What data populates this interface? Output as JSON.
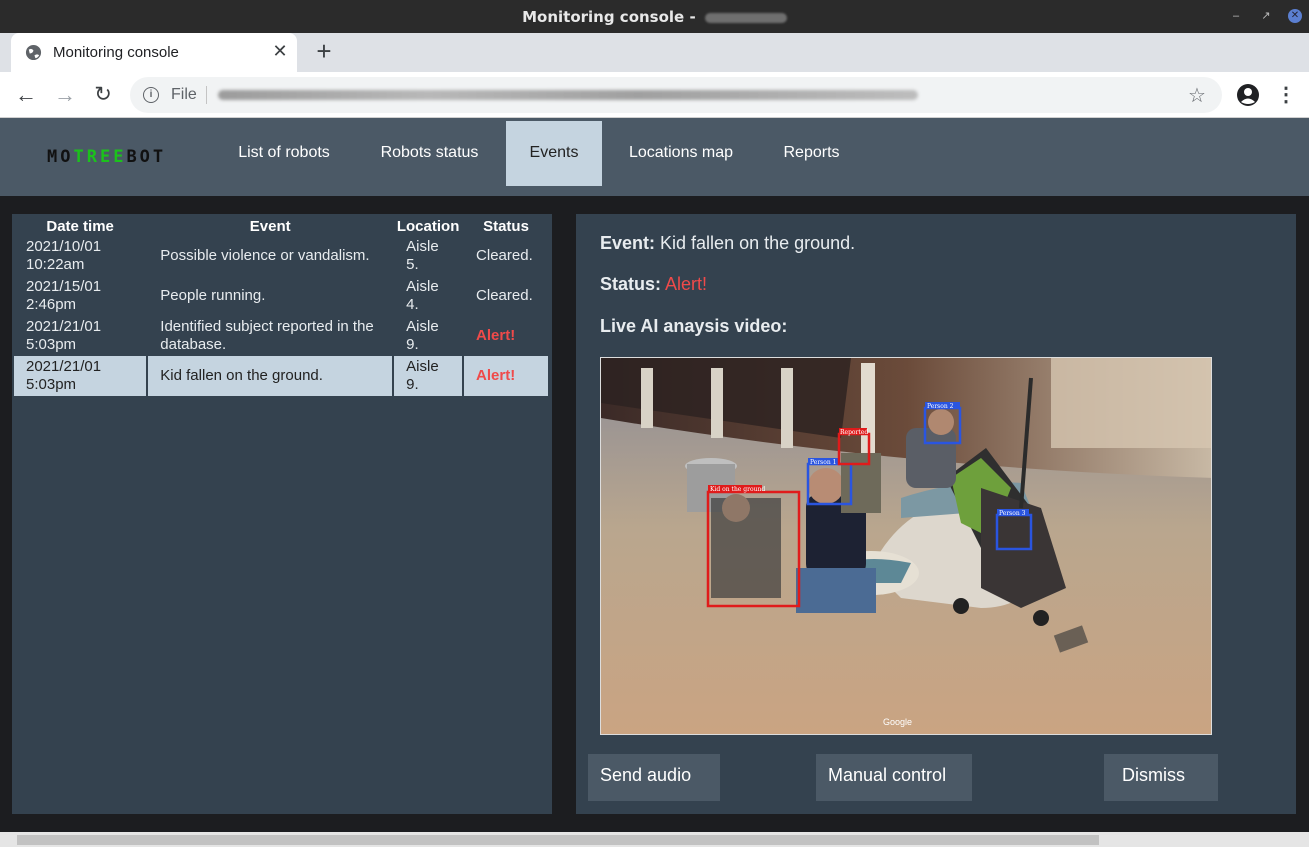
{
  "window": {
    "title": "Monitoring console - "
  },
  "browser": {
    "tab_title": "Monitoring console",
    "url_scheme": "File"
  },
  "app": {
    "logo": {
      "part1": "MO",
      "part2": "TREE",
      "part3": "BOT"
    },
    "nav": [
      {
        "label": "List of robots"
      },
      {
        "label": "Robots status"
      },
      {
        "label": "Events",
        "active": true
      },
      {
        "label": "Locations map"
      },
      {
        "label": "Reports"
      }
    ],
    "table": {
      "headers": [
        "Date time",
        "Event",
        "Location",
        "Status"
      ],
      "rows": [
        {
          "date": "2021/10/01",
          "time": "10:22am",
          "event": "Possible violence or vandalism.",
          "loc1": "Aisle",
          "loc2": "5.",
          "status": "Cleared."
        },
        {
          "date": "2021/15/01",
          "time": "2:46pm",
          "event": "People running.",
          "loc1": "Aisle",
          "loc2": "4.",
          "status": "Cleared."
        },
        {
          "date": "2021/21/01",
          "time": "5:03pm",
          "event": "Identified subject reported in the database.",
          "loc1": "Aisle",
          "loc2": "9.",
          "status": "Alert!"
        },
        {
          "date": "2021/21/01",
          "time": "5:03pm",
          "event": "Kid fallen on the ground.",
          "loc1": "Aisle",
          "loc2": "9.",
          "status": "Alert!",
          "selected": true
        }
      ]
    },
    "detail": {
      "event_label": "Event:",
      "event_value": "Kid fallen on the ground.",
      "status_label": "Status:",
      "status_value": "Alert!",
      "video_label": "Live AI anaysis video:",
      "video": {
        "boxes": [
          "Kid on the ground",
          "Person 1",
          "Reported",
          "Person 2",
          "Person 3"
        ],
        "watermark": "Google"
      },
      "buttons": {
        "send_audio": "Send audio",
        "manual_control": "Manual control",
        "dismiss": "Dismiss"
      }
    }
  },
  "colors": {
    "alert": "#ef4a4a",
    "nav_bg": "#4b5966",
    "panel_bg": "#34424f",
    "selected": "#c5d4e0",
    "logo_green": "#1cc21c"
  }
}
